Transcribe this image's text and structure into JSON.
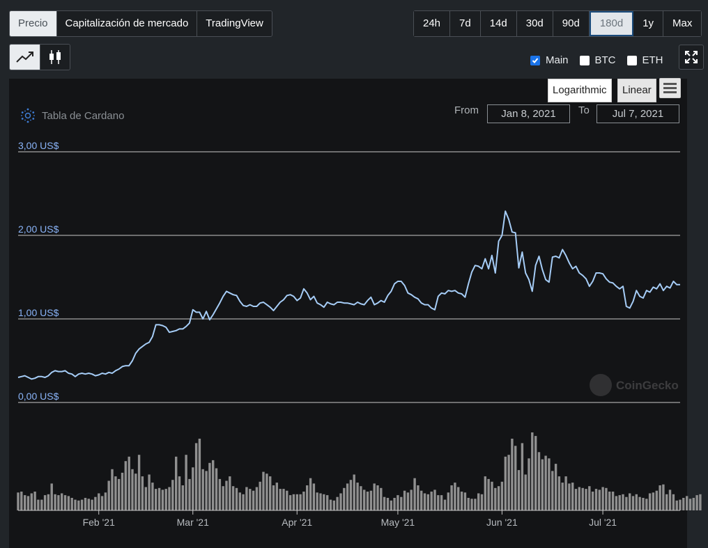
{
  "tabs": [
    "Precio",
    "Capitalización de mercado",
    "TradingView"
  ],
  "ranges": [
    "24h",
    "7d",
    "14d",
    "30d",
    "90d",
    "180d",
    "1y",
    "Max"
  ],
  "active_range": "180d",
  "toggles": [
    {
      "label": "Main",
      "checked": true
    },
    {
      "label": "BTC",
      "checked": false
    },
    {
      "label": "ETH",
      "checked": false
    }
  ],
  "scale": {
    "log": "Logarithmic",
    "linear": "Linear"
  },
  "title": "Tabla de Cardano",
  "range_inputs": {
    "from_label": "From",
    "from": "Jan 8, 2021",
    "to_label": "To",
    "to": "Jul 7, 2021"
  },
  "watermark": "CoinGecko",
  "colors": {
    "line": "#a6cdf7",
    "volume": "#909090",
    "tick": "#8ab4f8",
    "active_blue": "#1a73e8"
  },
  "chart_data": {
    "type": "line",
    "ylim": [
      0,
      3
    ],
    "y_ticks": [
      {
        "value": 0,
        "label": "0,00 US$"
      },
      {
        "value": 1,
        "label": "1,00 US$"
      },
      {
        "value": 2,
        "label": "2,00 US$"
      },
      {
        "value": 3,
        "label": "3,00 US$"
      }
    ],
    "x_ticks": [
      {
        "day": 24,
        "label": "Feb '21"
      },
      {
        "day": 52,
        "label": "Mar '21"
      },
      {
        "day": 83,
        "label": "Apr '21"
      },
      {
        "day": 113,
        "label": "May '21"
      },
      {
        "day": 144,
        "label": "Jun '21"
      },
      {
        "day": 174,
        "label": "Jul '21"
      }
    ],
    "price": [
      0.3,
      0.31,
      0.32,
      0.3,
      0.28,
      0.29,
      0.31,
      0.31,
      0.3,
      0.32,
      0.36,
      0.38,
      0.37,
      0.37,
      0.38,
      0.35,
      0.34,
      0.31,
      0.34,
      0.35,
      0.34,
      0.35,
      0.34,
      0.32,
      0.33,
      0.35,
      0.34,
      0.36,
      0.35,
      0.38,
      0.4,
      0.43,
      0.44,
      0.44,
      0.5,
      0.59,
      0.64,
      0.67,
      0.7,
      0.72,
      0.79,
      0.93,
      0.93,
      0.92,
      0.9,
      0.84,
      0.85,
      0.86,
      0.88,
      0.88,
      0.91,
      0.95,
      1.11,
      1.08,
      1.08,
      1.0,
      1.09,
      0.99,
      1.05,
      1.12,
      1.19,
      1.27,
      1.33,
      1.31,
      1.29,
      1.28,
      1.21,
      1.16,
      1.15,
      1.17,
      1.15,
      1.15,
      1.19,
      1.2,
      1.17,
      1.14,
      1.1,
      1.15,
      1.2,
      1.23,
      1.28,
      1.29,
      1.27,
      1.22,
      1.25,
      1.36,
      1.31,
      1.23,
      1.27,
      1.19,
      1.17,
      1.14,
      1.2,
      1.18,
      1.17,
      1.2,
      1.2,
      1.19,
      1.19,
      1.18,
      1.17,
      1.2,
      1.18,
      1.17,
      1.22,
      1.26,
      1.17,
      1.19,
      1.22,
      1.2,
      1.28,
      1.33,
      1.42,
      1.45,
      1.45,
      1.4,
      1.31,
      1.29,
      1.26,
      1.24,
      1.19,
      1.17,
      1.17,
      1.13,
      1.11,
      1.27,
      1.31,
      1.3,
      1.34,
      1.33,
      1.34,
      1.31,
      1.3,
      1.26,
      1.42,
      1.56,
      1.64,
      1.63,
      1.6,
      1.72,
      1.6,
      1.76,
      1.55,
      1.93,
      2.0,
      2.29,
      2.19,
      2.04,
      2.03,
      1.61,
      1.8,
      1.55,
      1.47,
      1.33,
      1.64,
      1.75,
      1.59,
      1.47,
      1.44,
      1.74,
      1.75,
      1.73,
      1.83,
      1.76,
      1.67,
      1.6,
      1.63,
      1.55,
      1.52,
      1.48,
      1.39,
      1.45,
      1.55,
      1.55,
      1.54,
      1.48,
      1.44,
      1.43,
      1.39,
      1.36,
      1.39,
      1.15,
      1.13,
      1.21,
      1.34,
      1.27,
      1.25,
      1.34,
      1.32,
      1.38,
      1.36,
      1.42,
      1.34,
      1.39,
      1.37,
      1.45,
      1.41,
      1.41
    ],
    "volume": [
      0.2,
      0.21,
      0.17,
      0.16,
      0.19,
      0.21,
      0.12,
      0.12,
      0.17,
      0.18,
      0.3,
      0.18,
      0.17,
      0.19,
      0.17,
      0.16,
      0.14,
      0.12,
      0.11,
      0.12,
      0.14,
      0.13,
      0.12,
      0.15,
      0.19,
      0.16,
      0.2,
      0.33,
      0.46,
      0.38,
      0.35,
      0.42,
      0.55,
      0.6,
      0.46,
      0.41,
      0.62,
      0.38,
      0.26,
      0.4,
      0.31,
      0.24,
      0.25,
      0.23,
      0.24,
      0.26,
      0.34,
      0.6,
      0.38,
      0.28,
      0.62,
      0.35,
      0.48,
      0.75,
      0.8,
      0.46,
      0.44,
      0.53,
      0.56,
      0.47,
      0.35,
      0.27,
      0.33,
      0.38,
      0.27,
      0.25,
      0.2,
      0.18,
      0.26,
      0.24,
      0.22,
      0.26,
      0.32,
      0.43,
      0.41,
      0.38,
      0.28,
      0.31,
      0.24,
      0.24,
      0.22,
      0.17,
      0.18,
      0.18,
      0.18,
      0.21,
      0.28,
      0.36,
      0.3,
      0.2,
      0.19,
      0.18,
      0.17,
      0.12,
      0.11,
      0.15,
      0.19,
      0.25,
      0.3,
      0.34,
      0.4,
      0.31,
      0.27,
      0.23,
      0.21,
      0.22,
      0.3,
      0.28,
      0.25,
      0.15,
      0.14,
      0.11,
      0.14,
      0.17,
      0.15,
      0.22,
      0.2,
      0.23,
      0.36,
      0.28,
      0.22,
      0.19,
      0.18,
      0.21,
      0.23,
      0.17,
      0.17,
      0.12,
      0.2,
      0.28,
      0.31,
      0.26,
      0.21,
      0.2,
      0.14,
      0.13,
      0.13,
      0.19,
      0.18,
      0.38,
      0.35,
      0.32,
      0.25,
      0.27,
      0.32,
      0.6,
      0.62,
      0.8,
      0.72,
      0.45,
      0.75,
      0.4,
      0.58,
      0.87,
      0.83,
      0.65,
      0.57,
      0.61,
      0.58,
      0.44,
      0.52,
      0.38,
      0.31,
      0.38,
      0.3,
      0.31,
      0.24,
      0.26,
      0.25,
      0.24,
      0.27,
      0.21,
      0.24,
      0.23,
      0.26,
      0.25,
      0.21,
      0.21,
      0.16,
      0.17,
      0.18,
      0.15,
      0.19,
      0.16,
      0.18,
      0.15,
      0.14,
      0.13,
      0.19,
      0.2,
      0.22,
      0.28,
      0.29,
      0.18,
      0.23,
      0.18,
      0.11,
      0.12,
      0.14,
      0.16,
      0.13,
      0.14,
      0.17,
      0.18
    ]
  }
}
